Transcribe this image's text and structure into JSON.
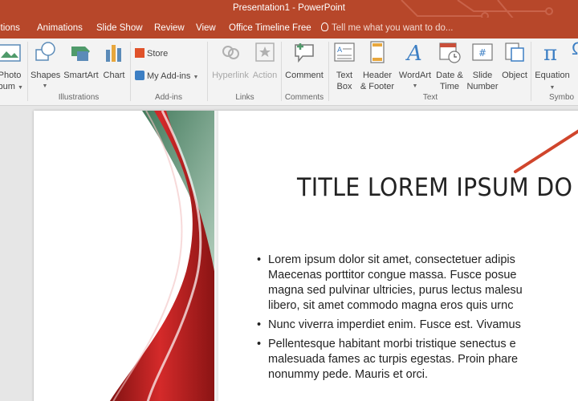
{
  "window": {
    "title": "Presentation1 - PowerPoint"
  },
  "tabs": [
    {
      "label": "itions"
    },
    {
      "label": "Animations"
    },
    {
      "label": "Slide Show"
    },
    {
      "label": "Review"
    },
    {
      "label": "View"
    },
    {
      "label": "Office Timeline Free"
    }
  ],
  "tell_me": {
    "placeholder": "Tell me what you want to do..."
  },
  "ribbon": {
    "photo_album": {
      "line1": "Photo",
      "line2": "lbum"
    },
    "shapes": "Shapes",
    "smartart": "SmartArt",
    "chart": "Chart",
    "store": "Store",
    "my_addins": "My Add-ins",
    "hyperlink": "Hyperlink",
    "action": "Action",
    "comment": "Comment",
    "textbox": {
      "line1": "Text",
      "line2": "Box"
    },
    "header_footer": {
      "line1": "Header",
      "line2": "& Footer"
    },
    "wordart": "WordArt",
    "date_time": {
      "line1": "Date &",
      "line2": "Time"
    },
    "slide_number": {
      "line1": "Slide",
      "line2": "Number"
    },
    "object": "Object",
    "equation": "Equation",
    "groups": {
      "illustrations": "Illustrations",
      "addins": "Add-ins",
      "links": "Links",
      "comments": "Comments",
      "text": "Text",
      "symbols": "Symbo"
    }
  },
  "slide": {
    "title": "TITLE LOREM IPSUM DO",
    "bullets": [
      {
        "lines": [
          "Lorem ipsum dolor sit amet, consectetuer adipis",
          "Maecenas porttitor congue massa. Fusce posue",
          "magna sed pulvinar ultricies, purus lectus malesu",
          "libero, sit amet commodo magna eros quis urnc"
        ]
      },
      {
        "lines": [
          "Nunc viverra imperdiet enim. Fusce est. Vivamus"
        ]
      },
      {
        "lines": [
          "Pellentesque habitant morbi tristique senectus e",
          "malesuada fames ac turpis egestas. Proin phare",
          "nonummy pede. Mauris et orci."
        ]
      }
    ]
  },
  "colors": {
    "accent": "#b7472a",
    "ribbon_bg": "#f3f3f3",
    "canvas": "#e6e6e6"
  }
}
